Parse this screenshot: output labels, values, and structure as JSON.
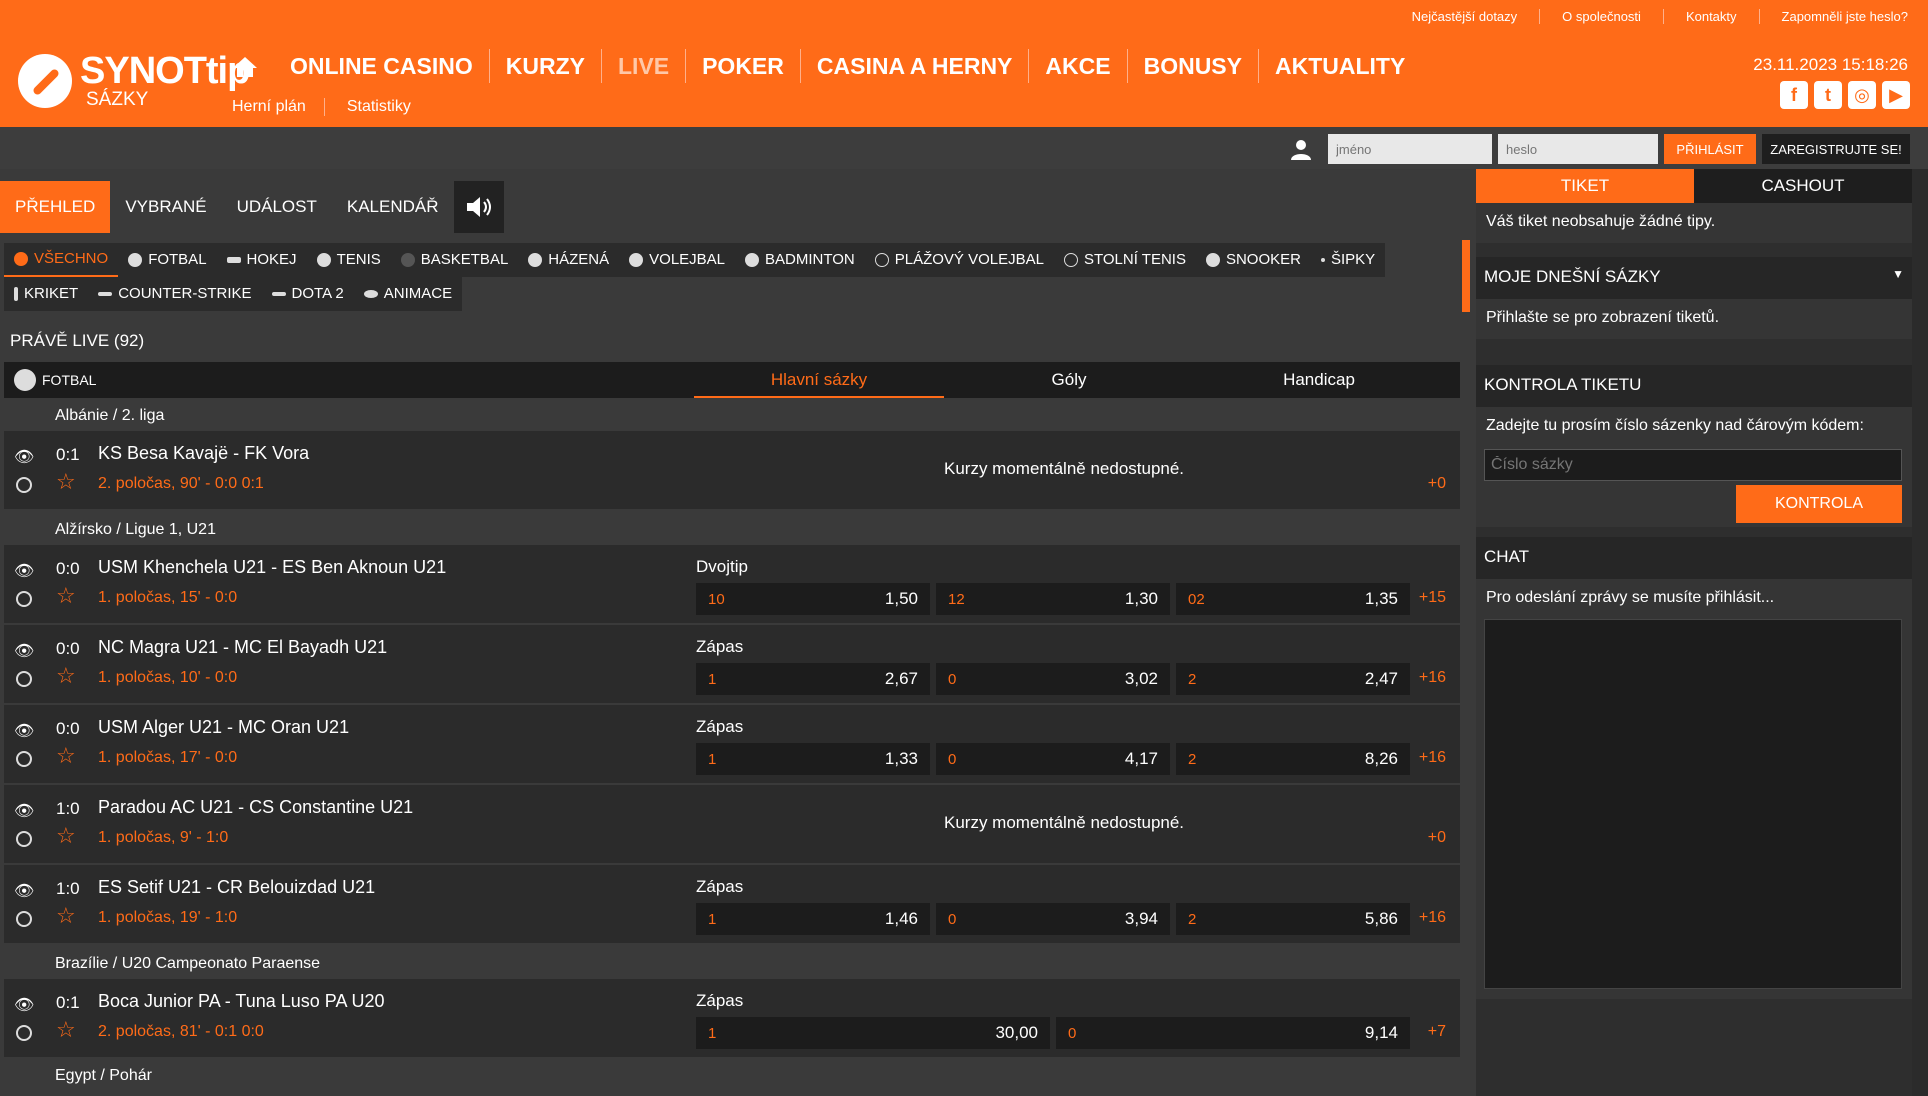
{
  "topbar": {
    "links": [
      "Nejčastější dotazy",
      "O společnosti",
      "Kontakty",
      "Zapomněli jste heslo?"
    ]
  },
  "header": {
    "logo_brand": "SYNOTtip",
    "logo_sub": "SÁZKY",
    "nav": [
      "ONLINE CASINO",
      "KURZY",
      "LIVE",
      "POKER",
      "CASINA A HERNY",
      "AKCE",
      "BONUSY",
      "AKTUALITY"
    ],
    "subnav": [
      "Herní plán",
      "Statistiky"
    ],
    "datetime": "23.11.2023 15:18:26",
    "social": [
      "f",
      "t",
      "◎",
      "▶"
    ]
  },
  "login": {
    "name_placeholder": "jméno",
    "pass_placeholder": "heslo",
    "login_label": "PŘIHLÁSIT",
    "register_label": "ZAREGISTRUJTE SE!"
  },
  "tabs": [
    "PŘEHLED",
    "VYBRANÉ",
    "UDÁLOST",
    "KALENDÁŘ"
  ],
  "sports": [
    "VŠECHNO",
    "FOTBAL",
    "HOKEJ",
    "TENIS",
    "BASKETBAL",
    "HÁZENÁ",
    "VOLEJBAL",
    "BADMINTON",
    "PLÁŽOVÝ VOLEJBAL",
    "STOLNÍ TENIS",
    "SNOOKER",
    "ŠIPKY",
    "KRIKET",
    "COUNTER-STRIKE",
    "DOTA 2",
    "ANIMACE"
  ],
  "live_title": "PRÁVĚ LIVE (92)",
  "event_header": {
    "sport": "FOTBAL",
    "tabs": [
      "Hlavní sázky",
      "Góly",
      "Handicap"
    ]
  },
  "leagues": [
    "Albánie / 2. liga",
    "Alžírsko / Ligue 1, U21",
    "Brazílie / U20 Campeonato Paraense",
    "Egypt / Pohár"
  ],
  "unavailable_text": "Kurzy momentálně nedostupné.",
  "events": [
    {
      "score": "0:1",
      "teams": "KS Besa Kavajë  -  FK Vora",
      "state": "2. poločas, 90' - 0:0  0:1",
      "more": "+0"
    },
    {
      "score": "0:0",
      "teams": "USM Khenchela U21  -  ES Ben Aknoun U21",
      "state": "1. poločas, 15' - 0:0",
      "market": "Dvojtip",
      "o1l": "10",
      "o1": "1,50",
      "o2l": "12",
      "o2": "1,30",
      "o3l": "02",
      "o3": "1,35",
      "more": "+15"
    },
    {
      "score": "0:0",
      "teams": "NC Magra U21  -  MC El Bayadh U21",
      "state": "1. poločas, 10' - 0:0",
      "market": "Zápas",
      "o1l": "1",
      "o1": "2,67",
      "o2l": "0",
      "o2": "3,02",
      "o3l": "2",
      "o3": "2,47",
      "more": "+16"
    },
    {
      "score": "0:0",
      "teams": "USM Alger U21  -  MC Oran U21",
      "state": "1. poločas, 17' - 0:0",
      "market": "Zápas",
      "o1l": "1",
      "o1": "1,33",
      "o2l": "0",
      "o2": "4,17",
      "o3l": "2",
      "o3": "8,26",
      "more": "+16"
    },
    {
      "score": "1:0",
      "teams": "Paradou AC U21  -  CS Constantine U21",
      "state": "1. poločas, 9' - 1:0",
      "more": "+0"
    },
    {
      "score": "1:0",
      "teams": "ES Setif U21  -  CR Belouizdad U21",
      "state": "1. poločas, 19' - 1:0",
      "market": "Zápas",
      "o1l": "1",
      "o1": "1,46",
      "o2l": "0",
      "o2": "3,94",
      "o3l": "2",
      "o3": "5,86",
      "more": "+16"
    },
    {
      "score": "0:1",
      "teams": "Boca Junior PA  -  Tuna Luso PA U20",
      "state": "2. poločas, 81' - 0:1  0:0",
      "market": "Zápas",
      "o1l": "1",
      "o1": "30,00",
      "o2l": "0",
      "o2": "9,14",
      "more": "+7"
    }
  ],
  "right": {
    "tabs": [
      "TIKET",
      "CASHOUT"
    ],
    "empty_ticket": "Váš tiket neobsahuje žádné tipy.",
    "my_bets": "MOJE DNEŠNÍ SÁZKY",
    "login_to_view": "Přihlašte se pro zobrazení tiketů.",
    "check_title": "KONTROLA TIKETU",
    "check_text": "Zadejte tu prosím číslo sázenky nad čárovým kódem:",
    "check_placeholder": "Číslo sázky",
    "check_button": "KONTROLA",
    "chat_title": "CHAT",
    "chat_text": "Pro odeslání zprávy se musíte přihlásit..."
  }
}
